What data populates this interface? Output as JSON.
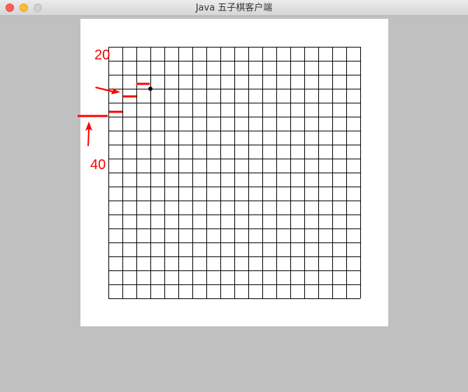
{
  "window": {
    "title": "Java 五子棋客户端"
  },
  "board": {
    "rows": 18,
    "cols": 18,
    "line_color": "#000000",
    "background": "#ffffff",
    "stone": {
      "col": 3,
      "row": 3,
      "color": "#000000"
    }
  },
  "annotations": {
    "color": "#ff0000",
    "label_20": "20",
    "label_40": "40"
  }
}
